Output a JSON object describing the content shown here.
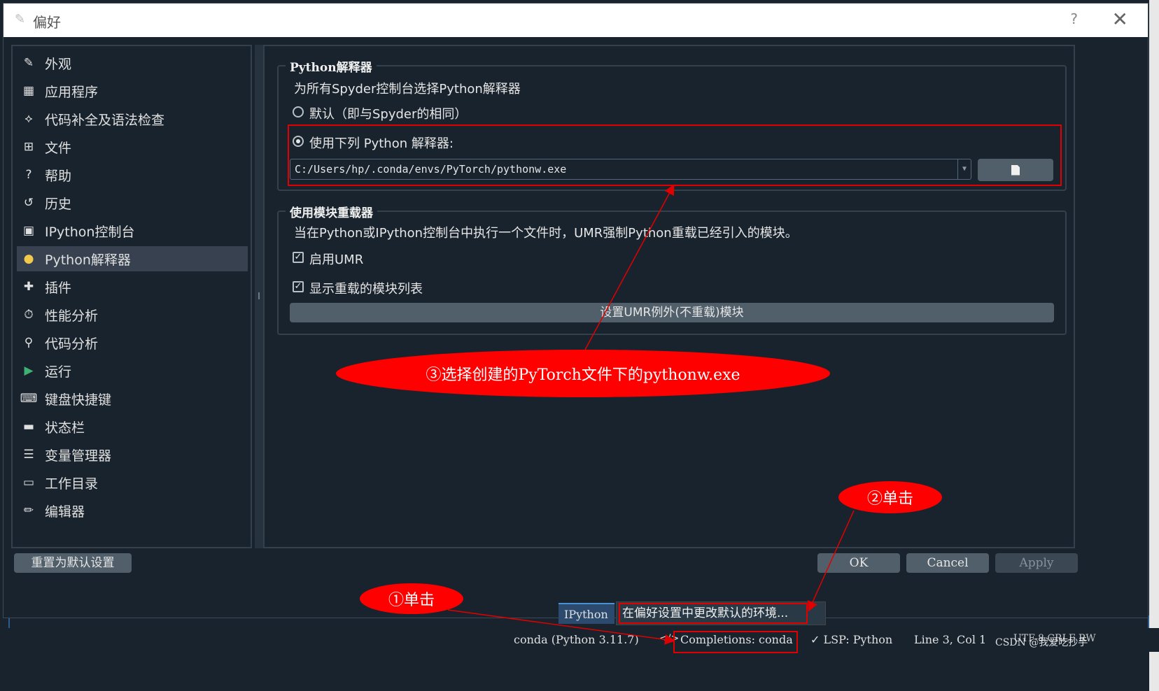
{
  "dialog": {
    "title": "偏好",
    "help_label": "?",
    "close_label": "✕"
  },
  "sidebar": {
    "items": [
      {
        "label": "外观",
        "icon": "brush-icon",
        "glyph": "✎"
      },
      {
        "label": "应用程序",
        "icon": "window-layout-icon",
        "glyph": "▦"
      },
      {
        "label": "代码补全及语法检查",
        "icon": "code-hint-icon",
        "glyph": "⟡"
      },
      {
        "label": "文件",
        "icon": "file-tree-icon",
        "glyph": "⊞"
      },
      {
        "label": "帮助",
        "icon": "question-circle-icon",
        "glyph": "?"
      },
      {
        "label": "历史",
        "icon": "history-icon",
        "glyph": "↺"
      },
      {
        "label": "IPython控制台",
        "icon": "terminal-icon",
        "glyph": "▣"
      },
      {
        "label": "Python解释器",
        "icon": "python-logo-icon",
        "glyph": "●"
      },
      {
        "label": "插件",
        "icon": "puzzle-icon",
        "glyph": "✚"
      },
      {
        "label": "性能分析",
        "icon": "stopwatch-icon",
        "glyph": "⏱"
      },
      {
        "label": "代码分析",
        "icon": "magnifier-icon",
        "glyph": "⚲"
      },
      {
        "label": "运行",
        "icon": "play-icon",
        "glyph": "▶"
      },
      {
        "label": "键盘快捷键",
        "icon": "keyboard-icon",
        "glyph": "⌨"
      },
      {
        "label": "状态栏",
        "icon": "statusbar-icon",
        "glyph": "▬"
      },
      {
        "label": "变量管理器",
        "icon": "list-icon",
        "glyph": "☰"
      },
      {
        "label": "工作目录",
        "icon": "folder-open-icon",
        "glyph": "▭"
      },
      {
        "label": "编辑器",
        "icon": "pencil-icon",
        "glyph": "✏"
      }
    ],
    "selected": "Python解释器",
    "reset_label": "重置为默认设置"
  },
  "interpreter_group": {
    "title": "Python解释器",
    "description": "为所有Spyder控制台选择Python解释器",
    "default_option": "默认（即与Spyder的相同）",
    "custom_option": "使用下列 Python 解释器:",
    "selected_option": "custom",
    "path_value": "C:/Users/hp/.conda/envs/PyTorch/pythonw.exe"
  },
  "umr_group": {
    "title": "使用模块重载器",
    "description": "当在Python或IPython控制台中执行一个文件时，UMR强制Python重载已经引入的模块。",
    "enable_label": "启用UMR",
    "enable_checked": true,
    "show_list_label": "显示重载的模块列表",
    "show_list_checked": true,
    "exclusions_button": "设置UMR例外(不重载)模块"
  },
  "buttons": {
    "ok": "OK",
    "cancel": "Cancel",
    "apply": "Apply"
  },
  "annotations": {
    "step1": "①单击",
    "step2": "②单击",
    "step3": "③选择创建的PyTorch文件下的pythonw.exe",
    "color": "#ff0000"
  },
  "popup": {
    "tab_label": "IPython控",
    "menu_item": "在偏好设置中更改默认的环境..."
  },
  "statusbar": {
    "env": "conda (Python 3.11.7)",
    "completions": "Completions: conda",
    "lsp": "✓ LSP: Python",
    "position": "Line 3, Col 1",
    "encoding": "UTF-8  CRLF  RW",
    "watermark": "CSDN @我爱吃抄手"
  }
}
